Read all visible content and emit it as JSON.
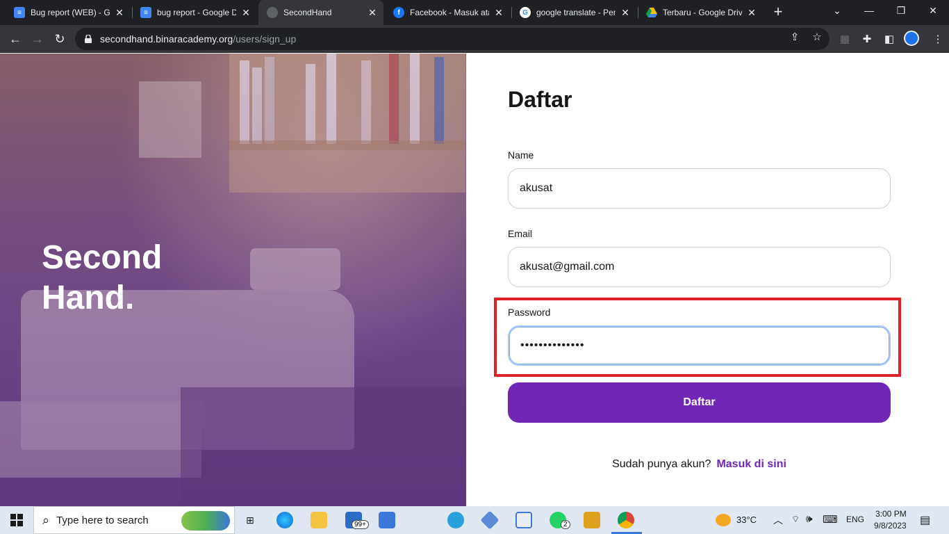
{
  "browser": {
    "tabs": [
      {
        "title": "Bug report (WEB) - Go",
        "icon": "google-docs-icon",
        "color": "#4285f4"
      },
      {
        "title": "bug report - Google D",
        "icon": "google-docs-icon",
        "color": "#4285f4"
      },
      {
        "title": "SecondHand",
        "icon": "globe-icon",
        "color": "#9aa0a6"
      },
      {
        "title": "Facebook - Masuk ata",
        "icon": "facebook-icon",
        "color": "#1877f2"
      },
      {
        "title": "google translate - Pen",
        "icon": "google-icon",
        "color": "#ffffff"
      },
      {
        "title": "Terbaru - Google Drive",
        "icon": "google-drive-icon",
        "color": "#fbbc04"
      }
    ],
    "url_host": "secondhand.binaracademy.org",
    "url_path": "/users/sign_up"
  },
  "hero": {
    "brand_line1": "Second",
    "brand_line2": "Hand."
  },
  "form": {
    "title": "Daftar",
    "name_label": "Name",
    "name_value": "akusat",
    "email_label": "Email",
    "email_value": "akusat@gmail.com",
    "password_label": "Password",
    "password_value": "••••••••••••••",
    "submit_label": "Daftar",
    "login_prompt": "Sudah punya akun?",
    "login_link": "Masuk di sini",
    "accent_color": "#7126b5",
    "highlight_color": "#e0202a"
  },
  "taskbar": {
    "search_placeholder": "Type here to search",
    "mail_badge": "99+",
    "whatsapp_badge": "2",
    "weather": "33°C",
    "language": "ENG",
    "time": "3:00 PM",
    "date": "9/8/2023"
  }
}
